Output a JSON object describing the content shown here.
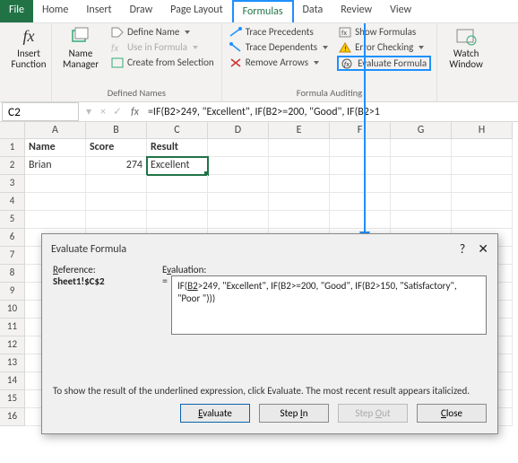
{
  "tabs": {
    "file": "File",
    "home": "Home",
    "insert": "Insert",
    "draw": "Draw",
    "pagelayout": "Page Layout",
    "formulas": "Formulas",
    "data": "Data",
    "review": "Review",
    "view": "View"
  },
  "ribbon": {
    "insertFunction": "Insert\nFunction",
    "nameManager": "Name\nManager",
    "defineName": "Define Name",
    "useInFormula": "Use in Formula",
    "createFromSelection": "Create from Selection",
    "definedNames": "Defined Names",
    "tracePrecedents": "Trace Precedents",
    "traceDependents": "Trace Dependents",
    "removeArrows": "Remove Arrows",
    "showFormulas": "Show Formulas",
    "errorChecking": "Error Checking",
    "evaluateFormula": "Evaluate Formula",
    "formulaAuditing": "Formula Auditing",
    "watchWindow": "Watch\nWindow"
  },
  "namebox": "C2",
  "fx": "fx",
  "formula": "=IF(B2>249, \"Excellent\", IF(B2>=200, \"Good\", IF(B2>1",
  "cols": [
    "A",
    "B",
    "C",
    "D",
    "E",
    "F",
    "G",
    "H"
  ],
  "hdr": {
    "a": "Name",
    "b": "Score",
    "c": "Result"
  },
  "row2": {
    "a": "Brian",
    "b": "274",
    "c": "Excellent"
  },
  "dialog": {
    "title": "Evaluate Formula",
    "refLabel": "Reference:",
    "ref": "Sheet1!$C$2",
    "evalLabel": "Evaluation:",
    "expr": "IF(<u>B2</u>>249, \"Excellent\", IF(B2>=200, \"Good\", IF(B2>150, \"Satisfactory\", \"Poor \")))",
    "hint": "To show the result of the underlined expression, click Evaluate.  The most recent result appears italicized.",
    "bEvaluate": "Evaluate",
    "bStepIn": "Step In",
    "bStepOut": "Step Out",
    "bClose": "Close"
  }
}
